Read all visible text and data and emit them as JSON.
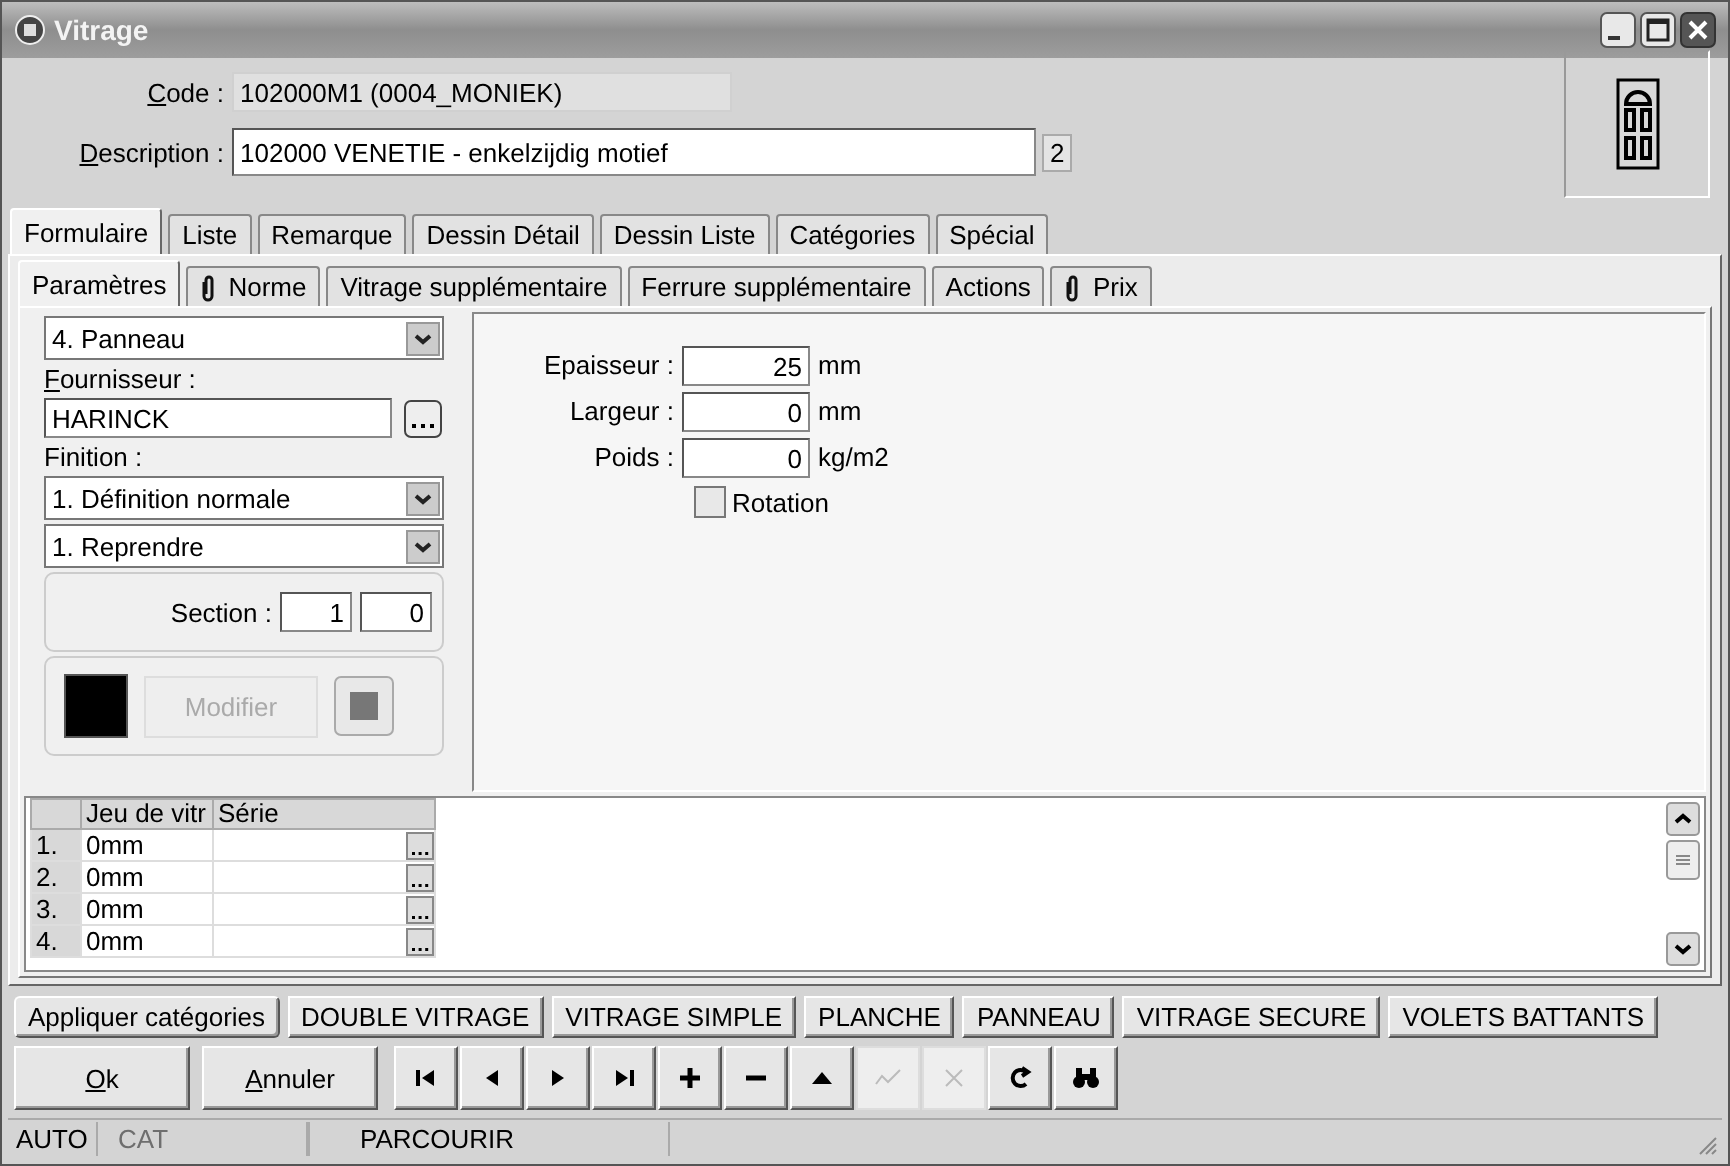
{
  "window": {
    "title": "Vitrage"
  },
  "header": {
    "code": {
      "label": "Code :",
      "value": "102000M1 (0004_MONIEK)"
    },
    "description": {
      "label": "Description :",
      "value": "102000 VENETIE - enkelzijdig motief",
      "badge": "2"
    }
  },
  "tabs": [
    {
      "label": "Formulaire",
      "selected": true
    },
    {
      "label": "Liste",
      "selected": false
    },
    {
      "label": "Remarque",
      "selected": false
    },
    {
      "label": "Dessin Détail",
      "selected": false
    },
    {
      "label": "Dessin Liste",
      "selected": false
    },
    {
      "label": "Catégories",
      "selected": false
    },
    {
      "label": "Spécial",
      "selected": false
    }
  ],
  "subtabs": [
    {
      "label": "Paramètres",
      "selected": true,
      "attachment": false
    },
    {
      "label": "Norme",
      "selected": false,
      "attachment": true
    },
    {
      "label": "Vitrage supplémentaire",
      "selected": false,
      "attachment": false
    },
    {
      "label": "Ferrure supplémentaire",
      "selected": false,
      "attachment": false
    },
    {
      "label": "Actions",
      "selected": false,
      "attachment": false
    },
    {
      "label": "Prix",
      "selected": false,
      "attachment": true
    }
  ],
  "left": {
    "type_select": "4.  Panneau",
    "supplier_label": "Fournisseur :",
    "supplier_value": "HARINCK",
    "finish_label": "Finition :",
    "finish_select": "1.  Définition normale",
    "mode_select": "1.  Reprendre",
    "section_label": "Section :",
    "section_values": [
      "1",
      "0"
    ],
    "color": "#000000",
    "modify_button": {
      "label": "Modifier",
      "disabled": true
    }
  },
  "measures": [
    {
      "label": "Epaisseur :",
      "value": "25",
      "unit": "mm"
    },
    {
      "label": "Largeur :",
      "value": "0",
      "unit": "mm"
    },
    {
      "label": "Poids :",
      "value": "0",
      "unit": "kg/m2"
    }
  ],
  "rotation": {
    "label": "Rotation",
    "checked": false
  },
  "grid": {
    "columns": [
      "Jeu de vitr",
      "Série"
    ],
    "rows": [
      {
        "index": "1.",
        "value": "0mm"
      },
      {
        "index": "2.",
        "value": "0mm"
      },
      {
        "index": "3.",
        "value": "0mm"
      },
      {
        "index": "4.",
        "value": "0mm"
      }
    ]
  },
  "category_buttons": [
    {
      "label": "Appliquer catégories",
      "kind": "apply"
    },
    {
      "label": "DOUBLE VITRAGE",
      "kind": "category"
    },
    {
      "label": "VITRAGE SIMPLE",
      "kind": "category"
    },
    {
      "label": "PLANCHE",
      "kind": "category"
    },
    {
      "label": "PANNEAU",
      "kind": "category"
    },
    {
      "label": "VITRAGE SECURE",
      "kind": "category"
    },
    {
      "label": "VOLETS BATTANTS",
      "kind": "category"
    }
  ],
  "actions": [
    {
      "label": "Ok"
    },
    {
      "label": "Annuler"
    }
  ],
  "nav_buttons": [
    {
      "kind": "first",
      "disabled": false
    },
    {
      "kind": "prev",
      "disabled": false
    },
    {
      "kind": "next",
      "disabled": false
    },
    {
      "kind": "last",
      "disabled": false
    },
    {
      "kind": "add",
      "disabled": false
    },
    {
      "kind": "remove",
      "disabled": false
    },
    {
      "kind": "up",
      "disabled": false
    },
    {
      "kind": "confirm",
      "disabled": true
    },
    {
      "kind": "cancel",
      "disabled": true
    },
    {
      "kind": "refresh",
      "disabled": false
    },
    {
      "kind": "find",
      "disabled": false
    }
  ],
  "status_bar": [
    {
      "text": "AUTO",
      "disabled": false
    },
    {
      "text": "CAT",
      "disabled": true
    },
    {
      "text": "PARCOURIR",
      "disabled": false
    }
  ]
}
